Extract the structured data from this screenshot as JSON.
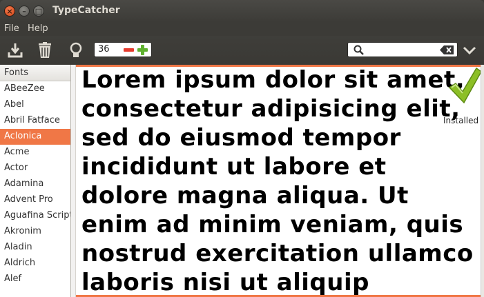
{
  "window": {
    "title": "TypeCatcher"
  },
  "menu": {
    "file": "File",
    "help": "Help"
  },
  "toolbar": {
    "download_icon": "download-icon",
    "trash_icon": "trash-icon",
    "bulb_icon": "lightbulb-icon",
    "font_size": "36",
    "search_value": "",
    "dropdown_icon": "chevron-down-icon"
  },
  "sidebar": {
    "header": "Fonts",
    "items": [
      "ABeeZee",
      "Abel",
      "Abril Fatface",
      "Aclonica",
      "Acme",
      "Actor",
      "Adamina",
      "Advent Pro",
      "Aguafina Script",
      "Akronim",
      "Aladin",
      "Aldrich",
      "Alef"
    ],
    "selected_index": 3
  },
  "preview": {
    "text": "Lorem ipsum dolor sit amet, consectetur adipisicing elit, sed do eiusmod tempor incididunt ut labore et dolore magna aliqua. Ut enim ad minim veniam, quis nostrud exercitation ullamco laboris nisi ut aliquip",
    "status": "Installed"
  },
  "colors": {
    "accent": "#f07746",
    "titlebar": "#3c3b37"
  }
}
